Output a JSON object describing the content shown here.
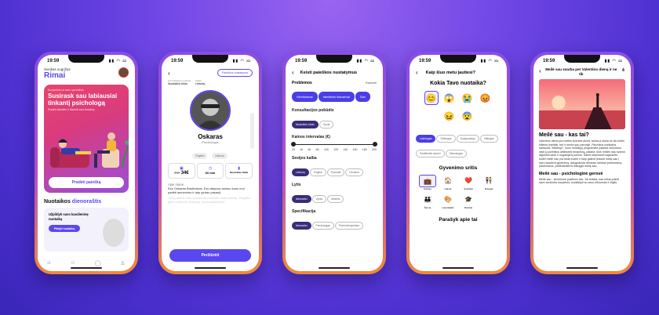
{
  "s1": {
    "time": "19:59",
    "greeting": "Sveikas sugrįžęs",
    "name": "Rimai",
    "banner": {
      "tag": "Susipažink su savo specialistu",
      "title": "Susirask sau labiausiai tinkantį psichologą",
      "sub": "Pradėk šiandien ir išsirink savo tinkamą",
      "cta": "Pradėti paiešką"
    },
    "mood_title_a": "Nuotaikos ",
    "mood_title_b": "dienoraštis",
    "mood_card": "Užpildyk savo kasdieninę nuotaiką",
    "mood_btn": "Pildyti nuotaiką"
  },
  "s2": {
    "time": "19:59",
    "search_btn": "Paieškos nustatymai",
    "col1_label": "Konsultacijos pobūdis",
    "col1_val": "Nuotoliniu būdu",
    "col2_label": "Kalba",
    "col2_val": "Lietuvių",
    "name": "Oskaras",
    "role": "Psichologas",
    "langs": [
      "English",
      "Lietuvių"
    ],
    "old_price": "49€",
    "price": "34€",
    "duration": "60 min",
    "mode": "Nuotoliniu būdu",
    "about_title": "Apie mane",
    "about": "Esu Oskaras Bražinskas. Esu aktyvus asmuo kuris nori padėti asmenims ir taip geriau pasaulį.",
    "about_more": "Jūsų patirtis man kasdieniai pasirodo rasti patirčių. Pagalba gali ti reikia iki, tinkamą, kai susipažinsite.",
    "btn": "Peržiūrėti"
  },
  "s3": {
    "time": "19:59",
    "title": "Keisti paieškos nustatymus",
    "problems": "Problemos",
    "see_all": "Pažiūrėti",
    "problem_chips": [
      "Vienišumas",
      "Identiteto klausimai",
      "Sav"
    ],
    "consult": "Konsultacijos pobūdis",
    "consult_chips": [
      "Nuotoliniu būdu",
      "Gyvai"
    ],
    "price": "Kainos intervalas (€)",
    "ticks": [
      "20",
      "40",
      "60",
      "80",
      "100",
      "120",
      "140",
      "160",
      "180",
      "200"
    ],
    "lang": "Sesijos kalba",
    "lang_chips": [
      "Lietuvių",
      "English",
      "Русский",
      "Deutsch"
    ],
    "gender": "Lytis",
    "gender_chips": [
      "Nesvarbu",
      "Vyras",
      "Moteris"
    ],
    "spec": "Specifikacija",
    "spec_chips": [
      "Nesvarbu",
      "Psichologas",
      "Psichoterapeutas"
    ]
  },
  "s4": {
    "time": "19:59",
    "title": "Kaip šiuo metu jautiesi?",
    "question": "Kokia Tavo nuotaika?",
    "mood_chips": [
      "Laimingas",
      "Dėkingas",
      "Susijaudinęs",
      "Viltingas",
      "Pasitikintis savimi",
      "Žaismingas"
    ],
    "area": "Gyvenimo sritis",
    "areas": [
      "Darbas",
      "Namai",
      "Sveikata",
      "Draugai",
      "Šeima",
      "Laisvalaikis",
      "Mokslai",
      ""
    ],
    "bottom": "Parašyk apie tai"
  },
  "s5": {
    "time": "19:59",
    "title": "Meilė sau svarba per Valentino dieną ir ne tik",
    "h1": "Meilė sau - kas tai?",
    "p1": "Valentino diena yra meilės šventės diena, tačiau ji skirta ne tik meilei kitiems išreikšti, bet ir meilei sau parodyti. Psichikos sveikatos startuolis \"Mielėsjo\", kurio mobiliųjų programėlė padeda žmonėms rasti jų poreikius atitinkantį terapeutą, pataria: šios meilės sau svarba atgimimt save ir nugalėjimą savimi. Šama stiprinanti nuginantis, kodėl meilė sau yra tokia svarbi ir kaip galime įtraukti meilę sau į savo kasdienį gyvenimą, dauguausia dėmesio skiriant praminiamų pataninams, padedantiems išlaugyti meilę sau.",
    "h2": "Meilė sau - psichologinė gerovė",
    "p2": "Meilė sau - tai kelionė pozitiven link. Tai reiškia, kad reikia priimti save sunkiuba savyebes, susitaikyti su savo trūkumais ir elgtis"
  }
}
